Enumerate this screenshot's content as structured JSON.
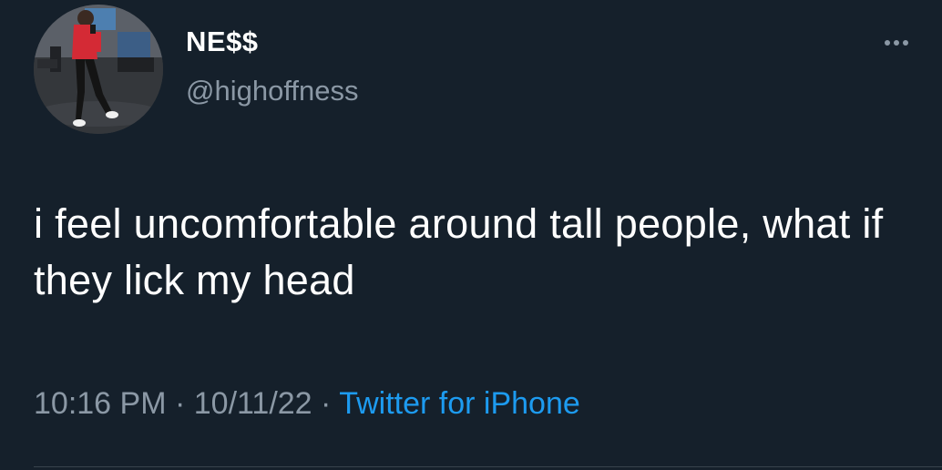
{
  "tweet": {
    "display_name": "NE$$",
    "handle": "@highoffness",
    "text": "i feel uncomfortable around tall people, what if they lick my head",
    "time": "10:16 PM",
    "separator": "·",
    "date": "10/11/22",
    "source": "Twitter for iPhone"
  },
  "icons": {
    "more": "more-horizontal-icon",
    "avatar": "profile-photo"
  },
  "colors": {
    "background": "#15202b",
    "primary_text": "#ffffff",
    "secondary_text": "#8b98a5",
    "link": "#1d9bf0",
    "avatar_jacket": "#d42a35"
  }
}
